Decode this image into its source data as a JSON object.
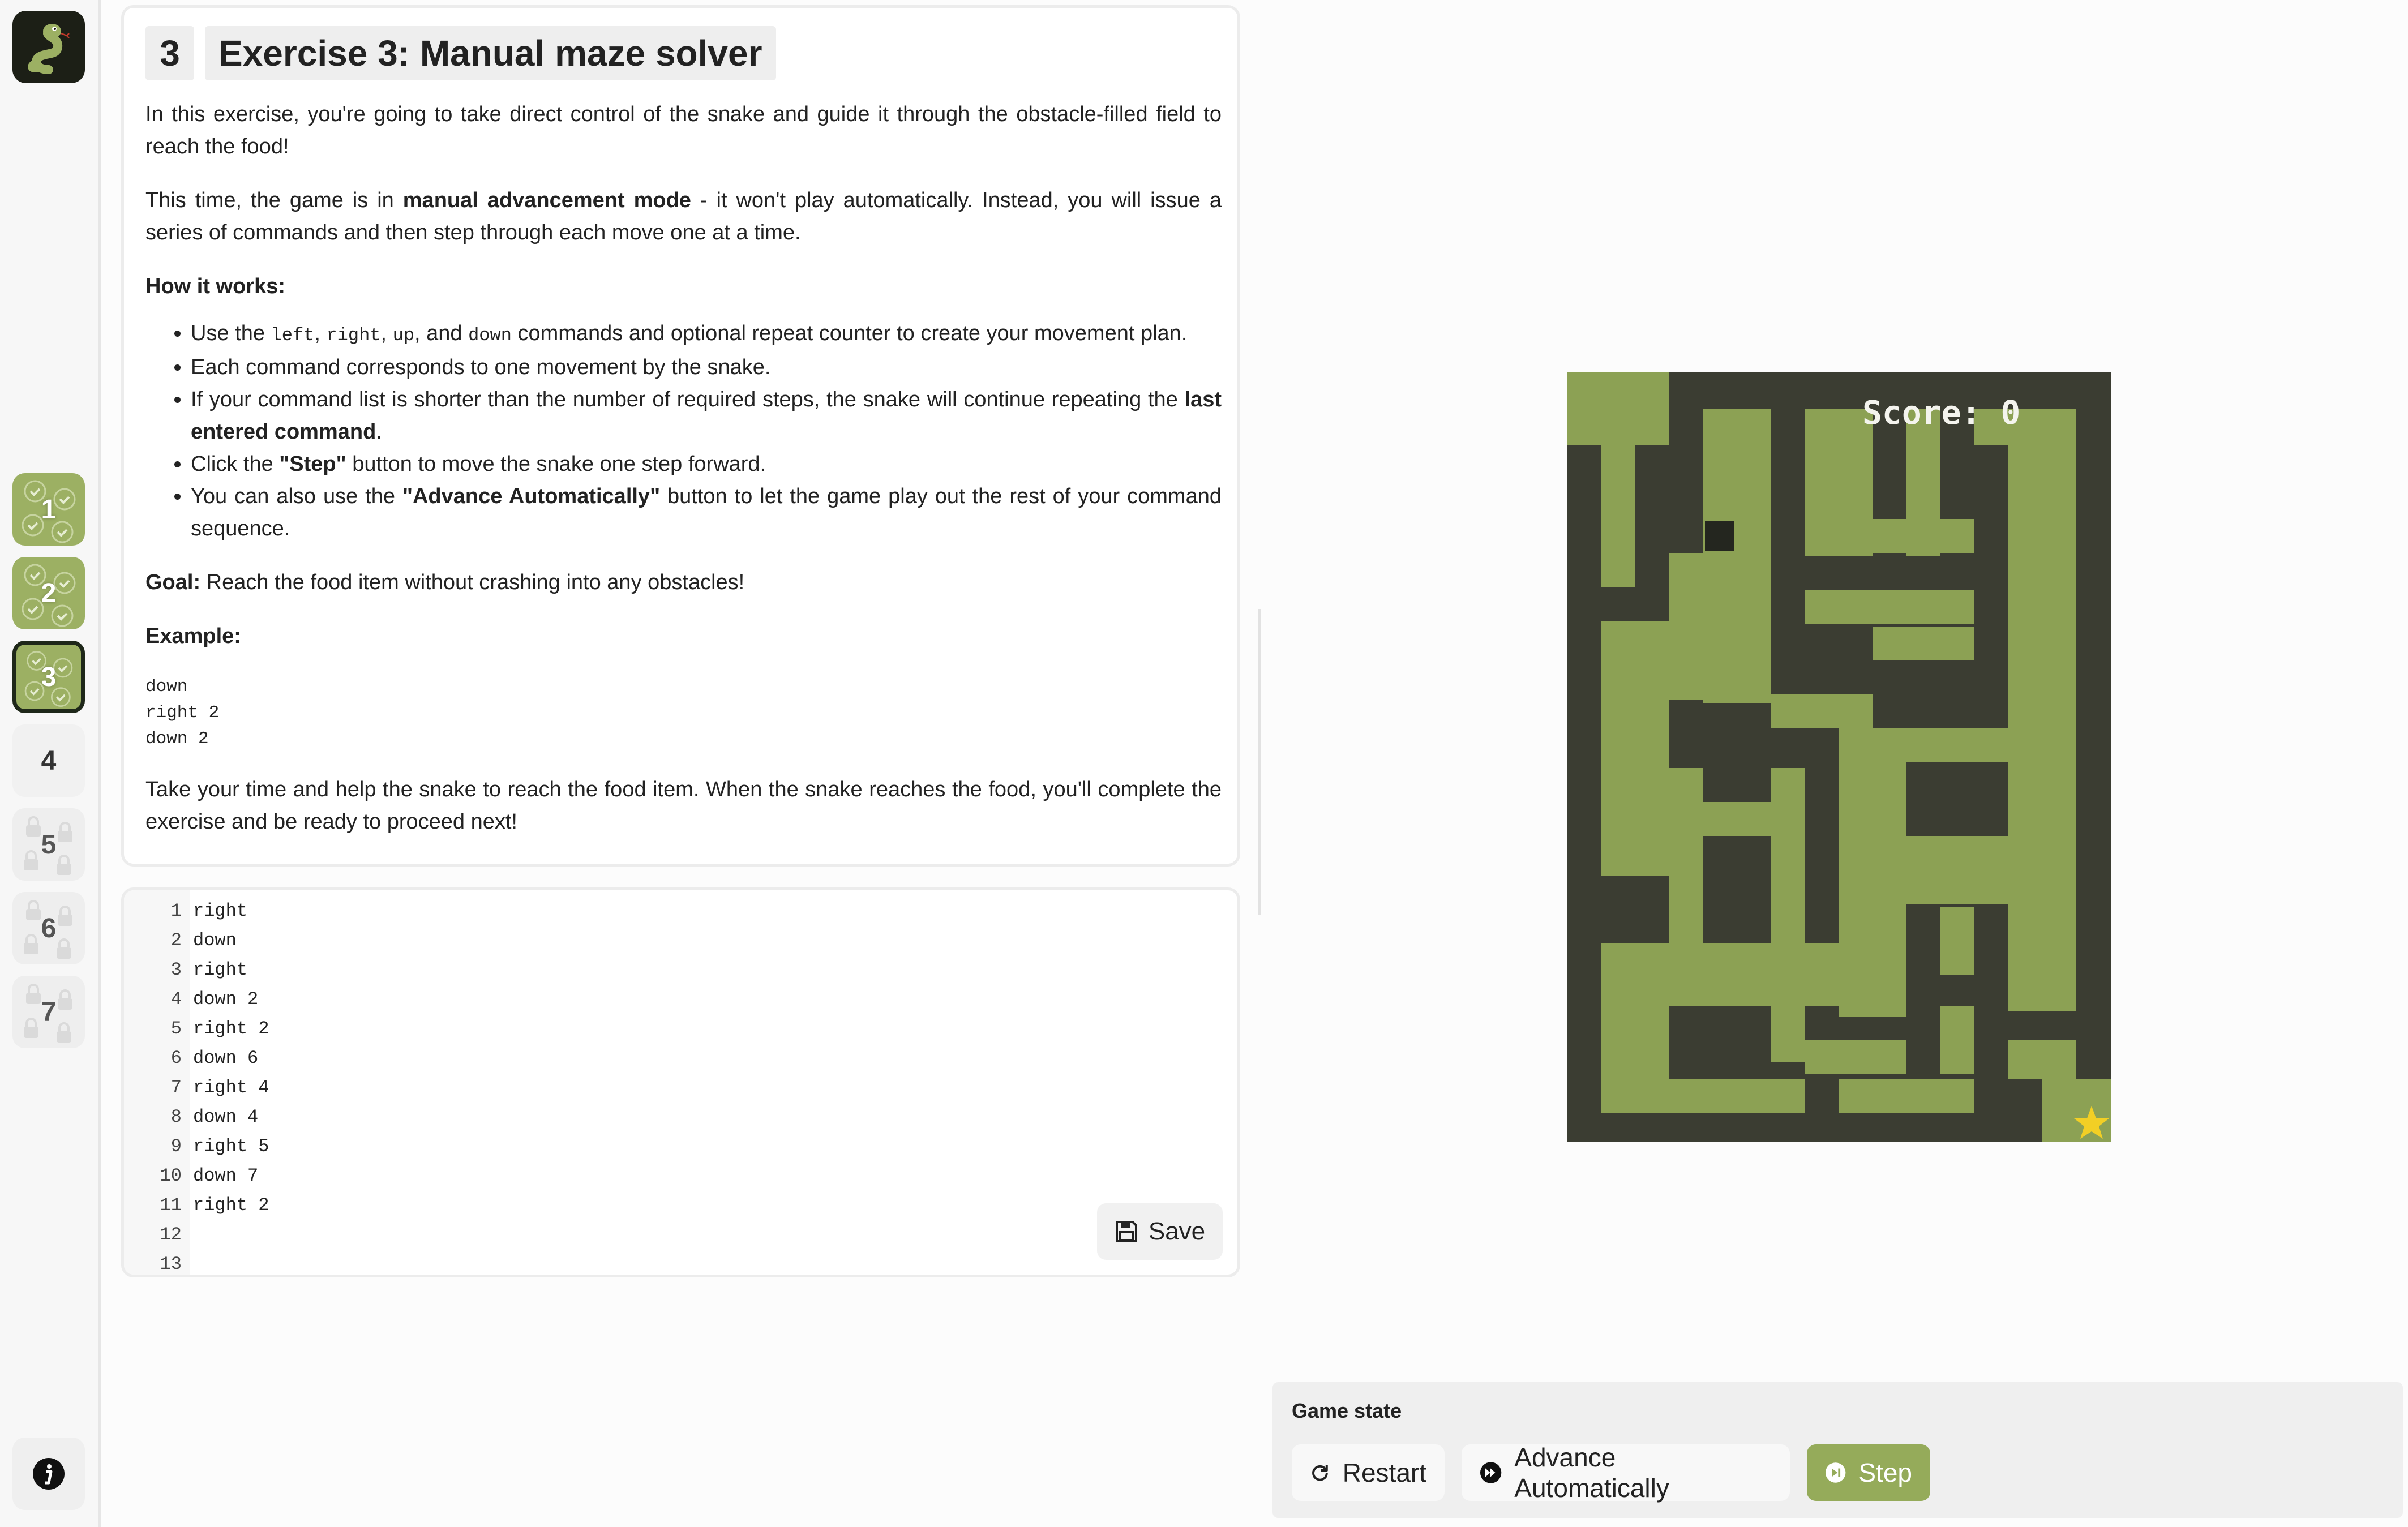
{
  "sidebar": {
    "logo_icon": "snake-icon",
    "levels": [
      {
        "label": "1",
        "state": "completed"
      },
      {
        "label": "2",
        "state": "completed"
      },
      {
        "label": "3",
        "state": "completed-active"
      },
      {
        "label": "4",
        "state": "unlocked"
      },
      {
        "label": "5",
        "state": "locked"
      },
      {
        "label": "6",
        "state": "locked"
      },
      {
        "label": "7",
        "state": "locked"
      }
    ],
    "info_icon": "info-icon"
  },
  "exercise": {
    "number": "3",
    "title": "Exercise 3: Manual maze solver",
    "intro": "In this exercise, you're going to take direct control of the snake and guide it through the obstacle-filled field to reach the food!",
    "mode_pre": "This time, the game is in ",
    "mode_bold": "manual advancement mode",
    "mode_post": " - it won't play automatically. Instead, you will issue a series of commands and then step through each move one at a time.",
    "how_heading": "How it works:",
    "bullet1_a": "Use the ",
    "bullet1_code_left": "left",
    "bullet1_sep1": ", ",
    "bullet1_code_right": "right",
    "bullet1_sep2": ", ",
    "bullet1_code_up": "up",
    "bullet1_sep3": ", and ",
    "bullet1_code_down": "down",
    "bullet1_b": " commands and optional repeat counter to create your movement plan.",
    "bullet2": "Each command corresponds to one movement by the snake.",
    "bullet3_a": "If your command list is shorter than the number of required steps, the snake will continue repeating the ",
    "bullet3_bold": "last entered command",
    "bullet3_b": ".",
    "bullet4_a": "Click the ",
    "bullet4_bold": "\"Step\"",
    "bullet4_b": " button to move the snake one step forward.",
    "bullet5_a": "You can also use the ",
    "bullet5_bold": "\"Advance Automatically\"",
    "bullet5_b": " button to let the game play out the rest of your command sequence.",
    "goal_label": "Goal:",
    "goal_text": " Reach the food item without crashing into any obstacles!",
    "example_heading": "Example:",
    "example_code": "down\nright 2\ndown 2",
    "outro": "Take your time and help the snake to reach the food item. When the snake reaches the food, you'll complete the exercise and be ready to proceed next!"
  },
  "editor": {
    "lines": [
      {
        "n": "1",
        "code": "right"
      },
      {
        "n": "2",
        "code": "down"
      },
      {
        "n": "3",
        "code": "right"
      },
      {
        "n": "4",
        "code": "down 2"
      },
      {
        "n": "5",
        "code": "right 2"
      },
      {
        "n": "6",
        "code": "down 6"
      },
      {
        "n": "7",
        "code": "right 4"
      },
      {
        "n": "8",
        "code": "down 4"
      },
      {
        "n": "9",
        "code": "right 5"
      },
      {
        "n": "10",
        "code": "down 7"
      },
      {
        "n": "11",
        "code": "right 2"
      },
      {
        "n": "12",
        "code": ""
      },
      {
        "n": "13",
        "code": ""
      }
    ],
    "save_label": "Save",
    "save_icon": "floppy-disk-icon"
  },
  "game": {
    "score_text": "Score: 0",
    "colors": {
      "wall": "#3b3d32",
      "floor": "#8ca154",
      "snake": "#24261f",
      "food": "#f2cf25"
    }
  },
  "game_state": {
    "label": "Game state",
    "restart_label": "Restart",
    "restart_icon": "restart-icon",
    "advance_label": "Advance Automatically",
    "advance_icon": "fast-forward-icon",
    "step_label": "Step",
    "step_icon": "step-forward-icon"
  }
}
